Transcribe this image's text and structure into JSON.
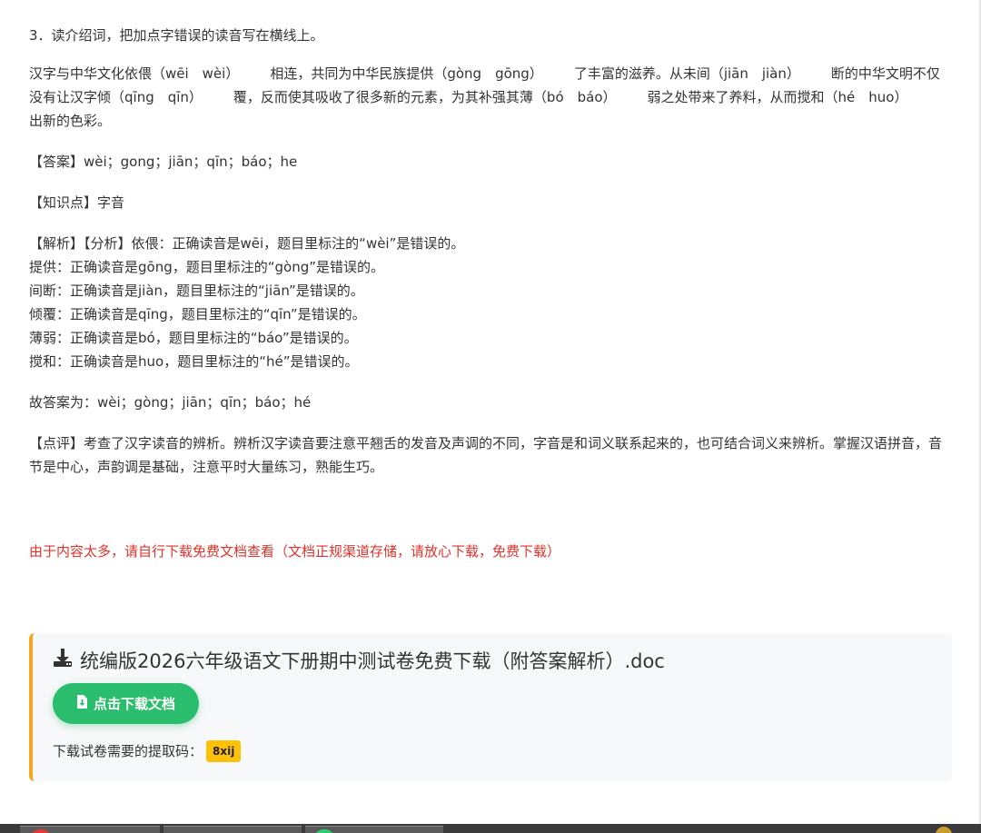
{
  "question": {
    "title": "3．读介绍词，把加点字错误的读音写在横线上。",
    "passage": {
      "s1": "汉字与中华文化依偎（wēi　wèi）",
      "s2": "相连，共同为中华民族提供（gòng　gōng）",
      "s3": "了丰富的滋养。从未间（jiān　jiàn）",
      "s4": "断的中华文明不仅没有让汉字倾（qīng　qīn）",
      "s5": "覆，反而使其吸收了很多新的元素，为其补强其薄（bó　báo）",
      "s6": "弱之处带来了养料，从而搅和（hé　huo）",
      "s7": "出新的色彩。"
    }
  },
  "answer": "【答案】wèi；gong；jiān；qīn；báo；he",
  "knowledge": "【知识点】字音",
  "analysis": [
    "【解析】【分析】依偎：正确读音是wēi，题目里标注的“wèi”是错误的。",
    "提供：正确读音是gōng，题目里标注的“gòng”是错误的。",
    "间断：正确读音是jiàn，题目里标注的“jiān”是错误的。",
    "倾覆：正确读音是qīng，题目里标注的“qīn”是错误的。",
    "薄弱：正确读音是bó，题目里标注的“báo”是错误的。",
    "搅和：正确读音是huo，题目里标注的“hé”是错误的。"
  ],
  "final_answer": "故答案为：wèi；gòng；jiān；qīn；báo；hé",
  "comment": "【点评】考查了汉字读音的辨析。辨析汉字读音要注意平翘舌的发音及声调的不同，字音是和词义联系起来的，也可结合词义来辨析。掌握汉语拼音，音节是中心，声韵调是基础，注意平时大量练习，熟能生巧。",
  "notice": "由于内容太多，请自行下载免费文档查看（文档正规渠道存储，请放心下载，免费下载）",
  "download": {
    "title": "统编版2026六年级语文下册期中测试卷免费下载（附答案解析）.doc",
    "button_label": "点击下载文档",
    "code_label": "下载试卷需要的提取码：",
    "code": "8xij",
    "accent_color": "#f5a623",
    "button_color": "#2bbd6e",
    "badge_color": "#ffc107"
  },
  "colors": {
    "notice": "#e0332b",
    "text": "#333333"
  }
}
